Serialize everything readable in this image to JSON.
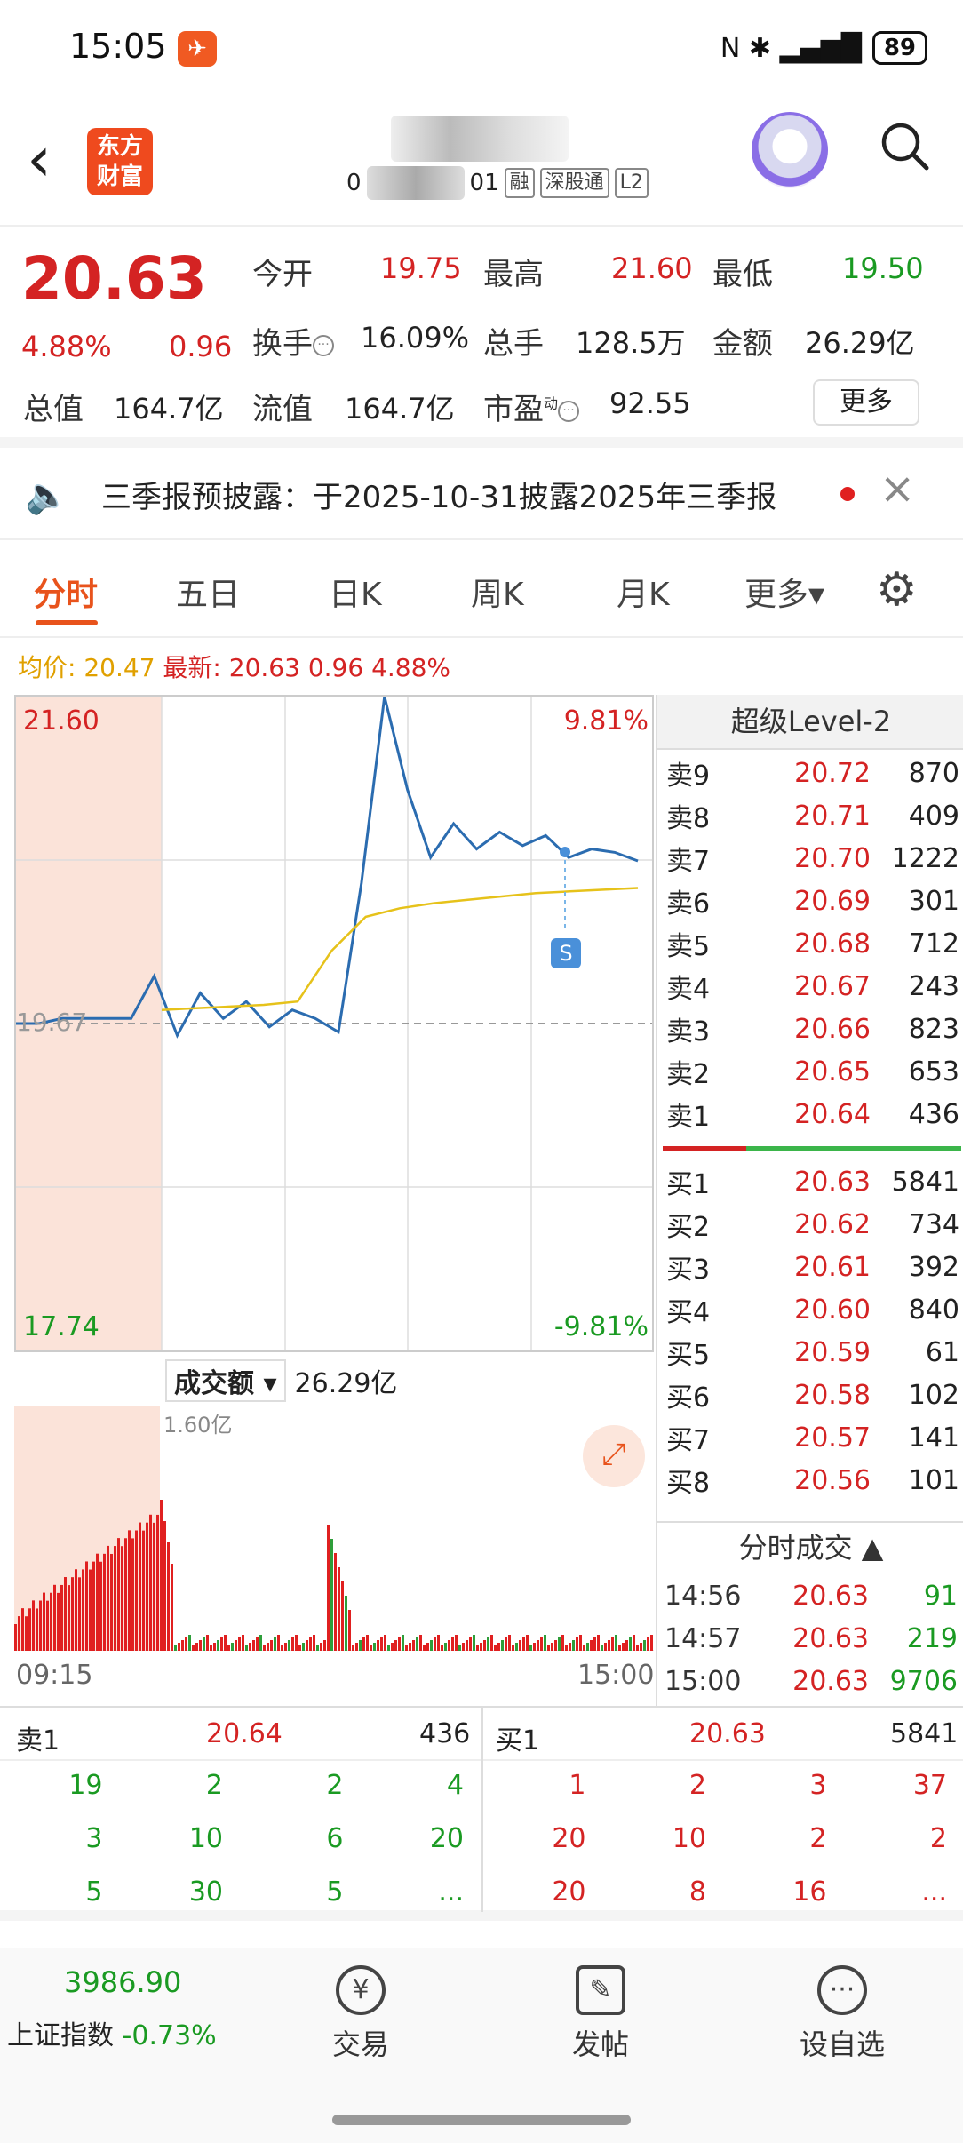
{
  "status_bar": {
    "time": "15:05",
    "battery": "89",
    "net": "N ✱ ▂▄▆█"
  },
  "header": {
    "logo": "东方\n财富",
    "tags": [
      "融",
      "深股通",
      "L2"
    ],
    "partial_code": "0",
    "partial_code2": "01"
  },
  "quote": {
    "price": "20.63",
    "pct": "4.88%",
    "change": "0.96",
    "labels": {
      "open": "今开",
      "high": "最高",
      "low": "最低",
      "turnover": "换手",
      "volume": "总手",
      "amount": "金额",
      "mktcap": "总值",
      "float": "流值",
      "pe": "市盈",
      "pe_sup": "动"
    },
    "open": "19.75",
    "high": "21.60",
    "low": "19.50",
    "turnover": "16.09%",
    "volume": "128.5万",
    "amount": "26.29亿",
    "mktcap": "164.7亿",
    "float": "164.7亿",
    "pe": "92.55",
    "more": "更多"
  },
  "notice": {
    "text": "三季报预披露：于2025-10-31披露2025年三季报"
  },
  "tabs": [
    "分时",
    "五日",
    "日K",
    "周K",
    "月K",
    "更多▾"
  ],
  "avg_line": {
    "avg_label": "均价:",
    "avg_value": "20.47",
    "latest_label": "最新:",
    "latest_value": "20.63 0.96 4.88%"
  },
  "chart": {
    "max_price": "21.60",
    "min_price": "17.74",
    "max_pct": "9.81%",
    "min_pct": "-9.81%",
    "prev_close": "19.67",
    "s_marker": "S",
    "vol_select": "成交额",
    "vol_total": "26.29亿",
    "vol_max": "1.60亿",
    "time_start": "09:15",
    "time_end": "15:00"
  },
  "chart_data": {
    "type": "line",
    "ylim": [
      17.74,
      21.6
    ],
    "series": [
      {
        "values": [
          19.67,
          19.67,
          19.7,
          19.7,
          19.7,
          19.7,
          19.95,
          19.6,
          19.85,
          19.7,
          19.8,
          19.65,
          19.75,
          19.7,
          19.62,
          20.5,
          21.6,
          21.05,
          20.65,
          20.85,
          20.7,
          20.8,
          20.72,
          20.78,
          20.65,
          20.7,
          20.68,
          20.63
        ]
      },
      {
        "values": [
          19.75,
          19.76,
          19.77,
          19.78,
          19.8,
          20.1,
          20.3,
          20.35,
          20.38,
          20.4,
          20.42,
          20.44,
          20.45,
          20.46,
          20.47
        ]
      }
    ]
  },
  "orderbook": {
    "title": "超级Level-2",
    "asks": [
      {
        "label": "卖9",
        "price": "20.72",
        "vol": "870"
      },
      {
        "label": "卖8",
        "price": "20.71",
        "vol": "409"
      },
      {
        "label": "卖7",
        "price": "20.70",
        "vol": "1222"
      },
      {
        "label": "卖6",
        "price": "20.69",
        "vol": "301"
      },
      {
        "label": "卖5",
        "price": "20.68",
        "vol": "712"
      },
      {
        "label": "卖4",
        "price": "20.67",
        "vol": "243"
      },
      {
        "label": "卖3",
        "price": "20.66",
        "vol": "823"
      },
      {
        "label": "卖2",
        "price": "20.65",
        "vol": "653"
      },
      {
        "label": "卖1",
        "price": "20.64",
        "vol": "436"
      }
    ],
    "bids": [
      {
        "label": "买1",
        "price": "20.63",
        "vol": "5841"
      },
      {
        "label": "买2",
        "price": "20.62",
        "vol": "734"
      },
      {
        "label": "买3",
        "price": "20.61",
        "vol": "392"
      },
      {
        "label": "买4",
        "price": "20.60",
        "vol": "840"
      },
      {
        "label": "买5",
        "price": "20.59",
        "vol": "61"
      },
      {
        "label": "买6",
        "price": "20.58",
        "vol": "102"
      },
      {
        "label": "买7",
        "price": "20.57",
        "vol": "141"
      },
      {
        "label": "买8",
        "price": "20.56",
        "vol": "101"
      }
    ],
    "ticks_title": "分时成交 ▲",
    "ticks": [
      {
        "time": "14:56",
        "price": "20.63",
        "vol": "91"
      },
      {
        "time": "14:57",
        "price": "20.63",
        "vol": "219"
      },
      {
        "time": "15:00",
        "price": "20.63",
        "vol": "9706"
      }
    ]
  },
  "queue": {
    "sell_label": "卖1",
    "sell_price": "20.64",
    "sell_vol": "436",
    "sell_items": [
      "19",
      "2",
      "2",
      "4",
      "3",
      "10",
      "6",
      "20",
      "5",
      "30",
      "5",
      "..."
    ],
    "buy_label": "买1",
    "buy_price": "20.63",
    "buy_vol": "5841",
    "buy_items": [
      "1",
      "2",
      "3",
      "37",
      "20",
      "10",
      "2",
      "2",
      "20",
      "8",
      "16",
      "..."
    ]
  },
  "bottom": {
    "index_value": "3986.90",
    "index_name": "上证指数",
    "index_pct": "-0.73%",
    "trade": "交易",
    "post": "发帖",
    "watch": "设自选"
  }
}
